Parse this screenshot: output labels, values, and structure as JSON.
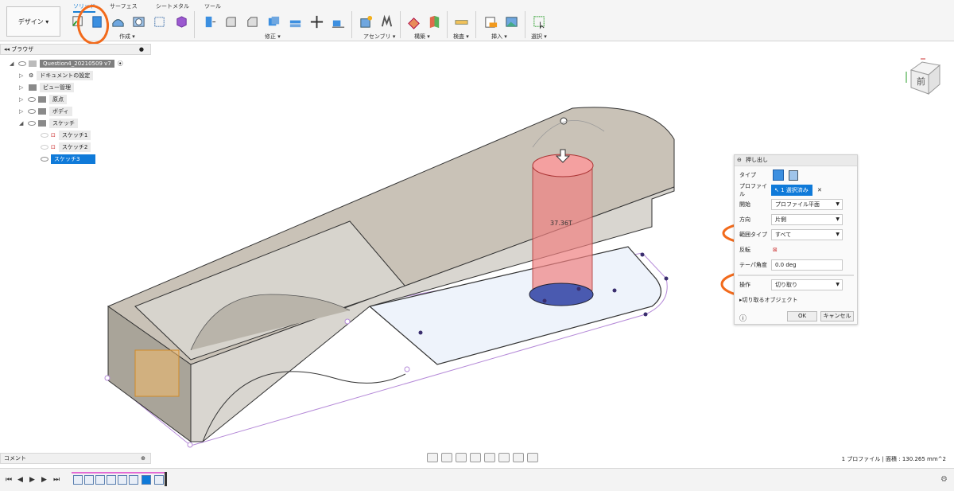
{
  "ribbon": {
    "workspace": "デザイン ▾",
    "tabs": [
      "ソリッド",
      "サーフェス",
      "シートメタル",
      "ツール"
    ],
    "groups": [
      "作成 ▾",
      "修正 ▾",
      "アセンブリ ▾",
      "構築 ▾",
      "検査 ▾",
      "挿入 ▾",
      "選択 ▾"
    ]
  },
  "browser": {
    "title": "ブラウザ",
    "root": "Question4_20210509 v7",
    "items": [
      "ドキュメントの設定",
      "ビュー管理",
      "原点",
      "ボディ",
      "スケッチ"
    ],
    "sketches": [
      "スケッチ1",
      "スケッチ2",
      "スケッチ3"
    ]
  },
  "dialog": {
    "title": "押し出し",
    "rows": [
      {
        "label": "タイプ",
        "value": ""
      },
      {
        "label": "プロファイル",
        "value": "1 選択済み"
      },
      {
        "label": "開始",
        "value": "プロファイル平面"
      },
      {
        "label": "方向",
        "value": "片側"
      },
      {
        "label": "範囲タイプ",
        "value": "すべて"
      },
      {
        "label": "反転",
        "value": ""
      },
      {
        "label": "テーパ角度",
        "value": "0.0 deg"
      },
      {
        "label": "操作",
        "value": "切り取り"
      }
    ],
    "objects_to_cut": "切り取るオブジェクト",
    "ok": "OK",
    "cancel": "キャンセル"
  },
  "viewport": {
    "dimension": "37.36T",
    "viewcube_face": "前"
  },
  "comment": "コメント",
  "status": "1 プロファイル | 面積 : 130.265 mm^2",
  "colors": {
    "accent": "#0f7ad9",
    "highlight": "#f26a1b",
    "body": "#c8c1b6",
    "cut": "#f08080"
  }
}
